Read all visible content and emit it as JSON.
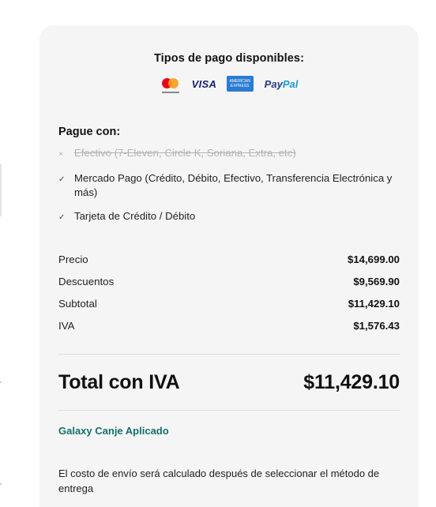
{
  "payment_types": {
    "title": "Tipos de pago disponibles:",
    "logos": [
      {
        "icon": "mastercard-logo"
      },
      {
        "icon": "visa-logo",
        "text": "VISA"
      },
      {
        "icon": "amex-logo",
        "text": "AMERICAN EXPRESS"
      },
      {
        "icon": "paypal-logo",
        "text_a": "Pay",
        "text_b": "Pal"
      }
    ]
  },
  "pay_with": {
    "title": "Pague con:",
    "methods": [
      {
        "mark": "×",
        "label": "Efectivo (7-Eleven, Circle K, Soriana, Extra, etc)",
        "available": false
      },
      {
        "mark": "✓",
        "label": "Mercado Pago (Crédito, Débito, Efectivo, Transferencia Electrónica y más)",
        "available": true
      },
      {
        "mark": "✓",
        "label": "Tarjeta de Crédito / Débito",
        "available": true
      }
    ]
  },
  "summary": {
    "rows": [
      {
        "label": "Precio",
        "value": "$14,699.00"
      },
      {
        "label": "Descuentos",
        "value": "$9,569.90"
      },
      {
        "label": "Subtotal",
        "value": "$11,429.10"
      },
      {
        "label": "IVA",
        "value": "$1,576.43"
      }
    ],
    "total_label": "Total con IVA",
    "total_value": "$11,429.10"
  },
  "galaxy_canje": "Galaxy Canje Aplicado",
  "shipping_note": "El costo de envío será calculado después de seleccionar el método de entrega",
  "colors": {
    "card_bg": "#f5f5f5",
    "accent_teal": "#14706a",
    "disabled_text": "#b3b3b3"
  }
}
